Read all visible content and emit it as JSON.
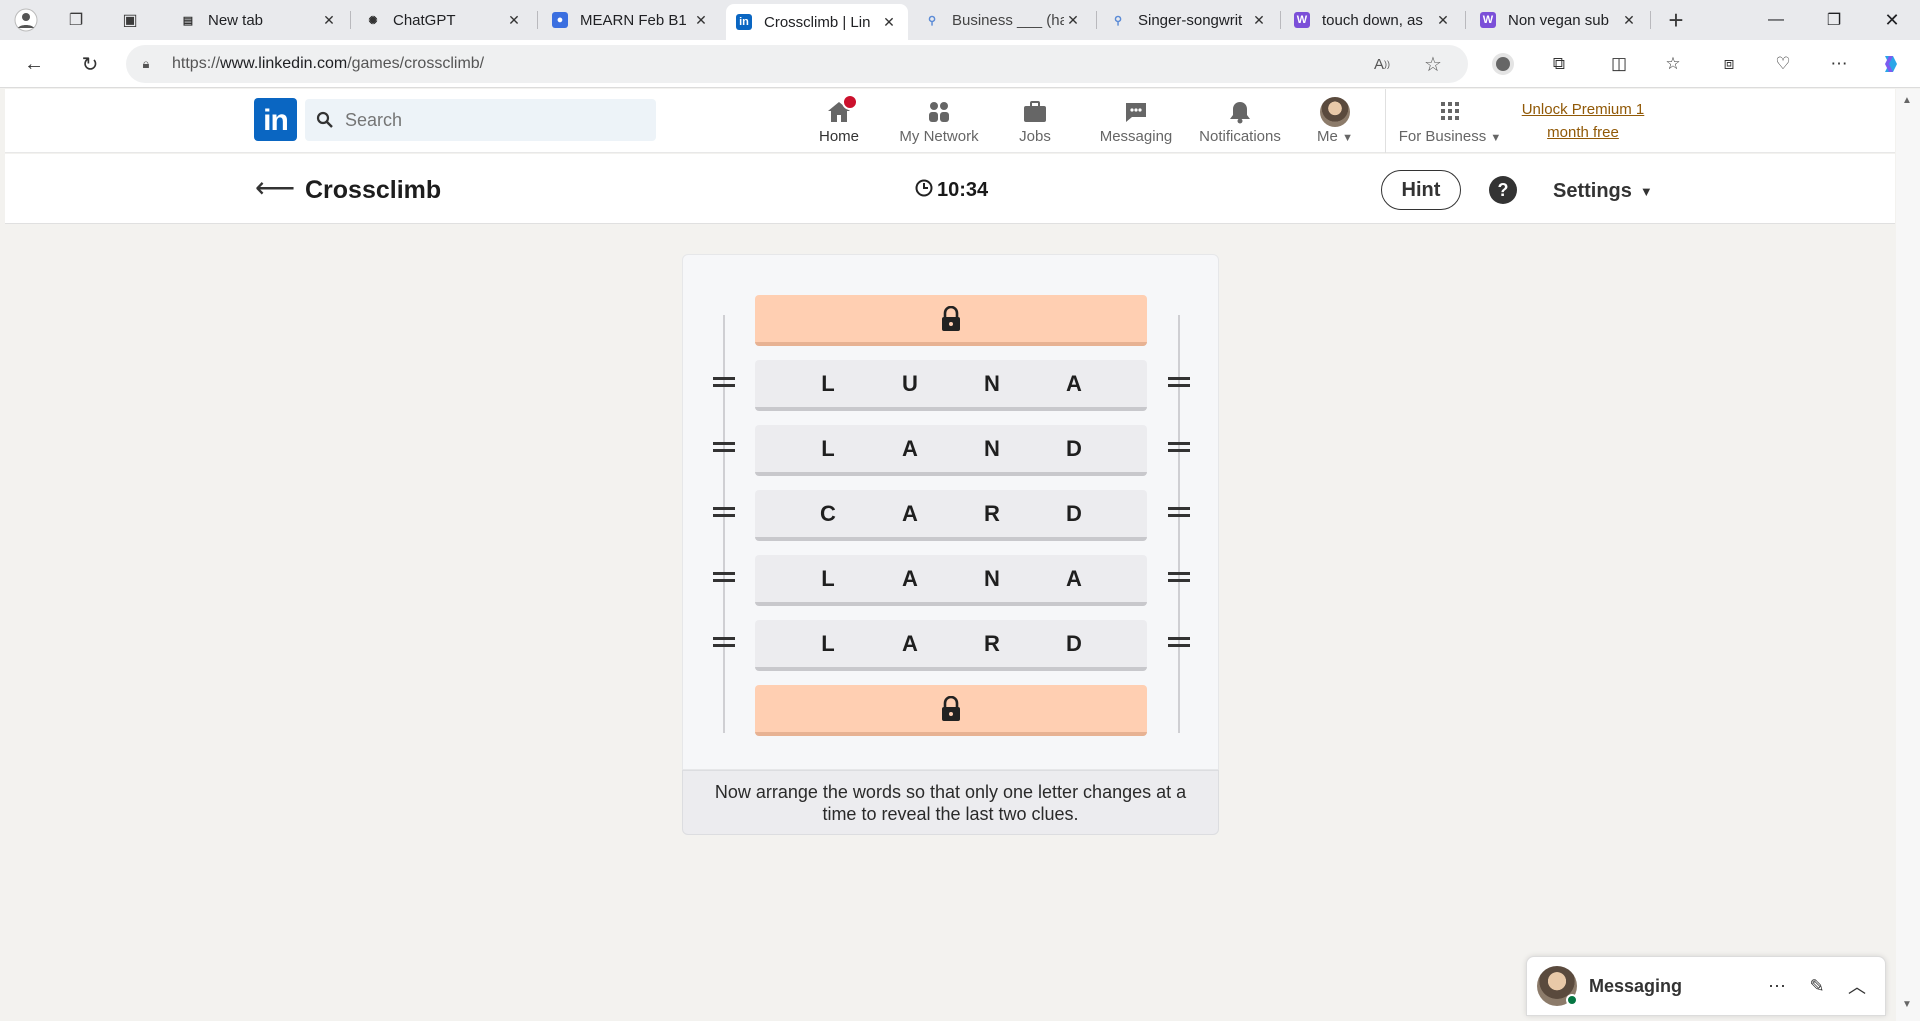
{
  "browser": {
    "tabs": [
      {
        "title": "New tab",
        "icon": "newtab-icon"
      },
      {
        "title": "ChatGPT",
        "icon": "chatgpt-icon"
      },
      {
        "title": "MEARN Feb B1",
        "icon": "contacts-icon"
      },
      {
        "title": "Crossclimb | Lin",
        "icon": "linkedin-icon",
        "active": true
      },
      {
        "title": "Business ___ (ha",
        "icon": "search-icon"
      },
      {
        "title": "Singer-songwrit",
        "icon": "search-icon"
      },
      {
        "title": "touch down, as",
        "icon": "w-icon"
      },
      {
        "title": "Non vegan sub",
        "icon": "w-icon"
      }
    ],
    "url_prefix": "https://",
    "url_domain": "www.linkedin.com",
    "url_path": "/games/crossclimb/"
  },
  "linkedin": {
    "logo_text": "in",
    "search_placeholder": "Search",
    "nav": {
      "home": "Home",
      "network": "My Network",
      "jobs": "Jobs",
      "messaging": "Messaging",
      "notifications": "Notifications",
      "me": "Me",
      "business": "For Business"
    },
    "premium_line1": "Unlock Premium 1",
    "premium_line2": "month free",
    "brand_color": "#0a66c2"
  },
  "game": {
    "title": "Crossclimb",
    "timer": "10:34",
    "hint_label": "Hint",
    "help_label": "?",
    "settings_label": "Settings",
    "rows": [
      {
        "letters": [
          "L",
          "U",
          "N",
          "A"
        ]
      },
      {
        "letters": [
          "L",
          "A",
          "N",
          "D"
        ]
      },
      {
        "letters": [
          "C",
          "A",
          "R",
          "D"
        ]
      },
      {
        "letters": [
          "L",
          "A",
          "N",
          "A"
        ]
      },
      {
        "letters": [
          "L",
          "A",
          "R",
          "D"
        ]
      }
    ],
    "instruction": "Now arrange the words so that only one letter changes at a time to reveal the last two clues.",
    "locked_row_color": "#ffcfb2"
  },
  "messaging": {
    "title": "Messaging"
  }
}
